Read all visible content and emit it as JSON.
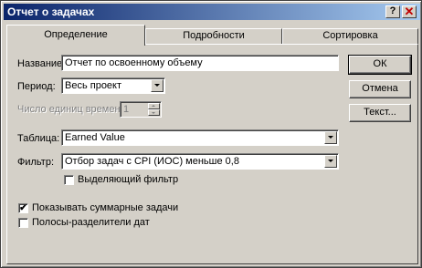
{
  "window": {
    "title": "Отчет о задачах",
    "help_glyph": "?",
    "close_glyph": "✕"
  },
  "tabs": [
    {
      "label": "Определение",
      "active": true
    },
    {
      "label": "Подробности",
      "active": false
    },
    {
      "label": "Сортировка",
      "active": false
    }
  ],
  "form": {
    "name_label": "Название:",
    "name_value": "Отчет по освоенному объему",
    "period_label": "Период:",
    "period_value": "Весь проект",
    "units_label": "Число единиц времени:",
    "units_value": "1",
    "table_label": "Таблица:",
    "table_value": "Earned Value",
    "filter_label": "Фильтр:",
    "filter_value": "Отбор задач с CPI (ИОС) меньше 0,8",
    "highlight_filter_label": "Выделяющий фильтр",
    "highlight_filter_checked": false,
    "show_summary_label": "Показывать суммарные задачи",
    "show_summary_checked": true,
    "gridlines_label": "Полосы-разделители дат",
    "gridlines_checked": false
  },
  "buttons": {
    "ok": "ОК",
    "cancel": "Отмена",
    "text": "Текст..."
  },
  "icons": {
    "check_glyph": "✔",
    "dropdown": "chevron-down-icon"
  }
}
